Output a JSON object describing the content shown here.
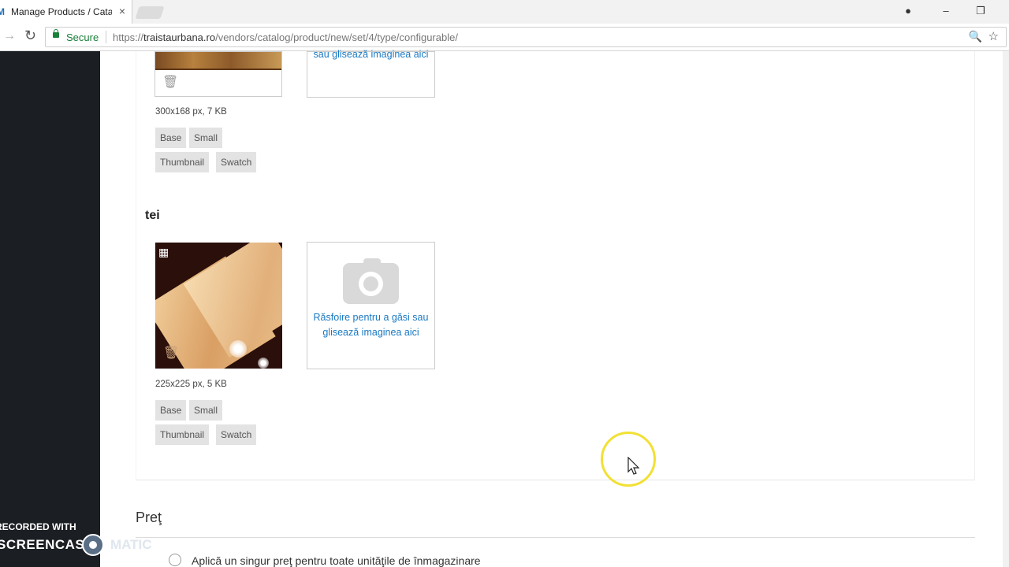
{
  "browser": {
    "tab_title": "Manage Products / Catalog",
    "tab_favicon": "M",
    "tab_close": "×",
    "secure_label": "Secure",
    "url_scheme": "https://",
    "url_domain": "traistaurbana.ro",
    "url_path": "/vendors/catalog/product/new/set/4/type/configurable/",
    "icons": [
      "lock-icon",
      "forward-icon",
      "reload-icon",
      "zoom-icon",
      "star-icon",
      "account-icon",
      "minimize-icon",
      "restore-icon"
    ]
  },
  "gallery": {
    "upload_text": "Răsfoire pentru a găsi sau glisează imaginea aici",
    "upload_text_partial": "sau glisează imaginea aici",
    "variants": [
      {
        "meta": "300x168 px, 7 KB",
        "roles": [
          "Base",
          "Small",
          "Thumbnail",
          "Swatch"
        ]
      },
      {
        "name": "tei",
        "meta": "225x225 px, 5 KB",
        "roles": [
          "Base",
          "Small",
          "Thumbnail",
          "Swatch"
        ]
      }
    ]
  },
  "price": {
    "heading": "Preţ",
    "option_label": "Aplică un singur preţ pentru toate unităţile de înmagazinare"
  },
  "watermark": {
    "line1": "RECORDED WITH",
    "line2": "SCREENCAST",
    "line3": "MATIC"
  }
}
